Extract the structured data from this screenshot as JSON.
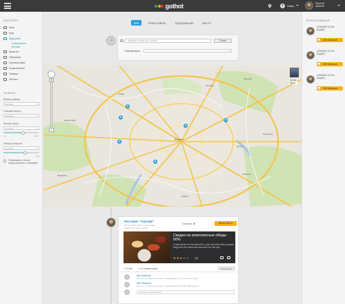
{
  "topbar": {
    "logo_text": "gothot",
    "logo_colors": [
      "#3aa54a",
      "#f5b400",
      "#e0312e"
    ],
    "language": "Нафо",
    "user_name_line1": "Личный",
    "user_name_line2": "кабинет"
  },
  "left": {
    "categories_title": "КАТЕГОРИИ",
    "categories": [
      {
        "label": "Авто",
        "icon": "car-icon"
      },
      {
        "label": "Еда",
        "icon": "fork-icon"
      },
      {
        "label": "Здоровье",
        "icon": "heart-icon",
        "active": true
      },
      {
        "label": "Красота",
        "icon": "lipstick-icon"
      },
      {
        "label": "Обучение",
        "icon": "book-icon"
      },
      {
        "label": "Путешествия",
        "icon": "plane-icon"
      },
      {
        "label": "Развлечения",
        "icon": "ticket-icon"
      },
      {
        "label": "Товары",
        "icon": "bag-icon"
      },
      {
        "label": "Фитнес",
        "icon": "dumbbell-icon"
      }
    ],
    "subcategories": [
      "Стоматология",
      "Нетупки"
    ],
    "filters_title": "ФИЛЬТРЫ",
    "district_label": "Выбор района",
    "district_value": "Выбрать",
    "metro_label": "Станция метро",
    "metro_value": "Выбрать",
    "price_label": "Фильтр цены",
    "price_value": "до 500 тг.",
    "price_min": "0 тг",
    "price_max": "500 тг",
    "bonus_label": "Фильтр бонусов",
    "bonus_value": "до 500 тг.",
    "bonus_min": "0",
    "bonus_max": "300",
    "price_level": 0.55,
    "bonus_level": 0.6,
    "checkbox_label": "Показывать только предложения с отзывами"
  },
  "tabs": [
    "Все",
    "Новости/Блог",
    "Предложения",
    "Места"
  ],
  "search": {
    "placeholder": "Введите слово для поиска",
    "button_label": "Поиск",
    "sort_label": "Сортировать:"
  },
  "map": {
    "side_label_line1": "Оранж",
    "side_label_line2": "Пров",
    "labels": [
      "Москва",
      "Химки",
      "Мытищи",
      "Балашиха",
      "Люберцы",
      "Красногорск",
      "Одинцово",
      "Королёв",
      "Реутов",
      "Видное"
    ]
  },
  "rewards": {
    "title": "ВОЗНАГРАЖДЕНИЕ",
    "items": [
      {
        "text_line1": "АЛЬФАН 16 Gb",
        "text_line2": "(Apple)",
        "badge": "200 бонусов"
      },
      {
        "text_line1": "АЛЬФАН 16 Gb",
        "text_line2": "(Apple)",
        "badge": "200 бонусов"
      },
      {
        "text_line1": "АЛЬФАН 16 Gb",
        "text_line2": "(Apple)",
        "badge": "200 бонусов"
      }
    ]
  },
  "post": {
    "place": "Ресторан \"Тартюф\"",
    "meta1": "25 Сентября 2013 в 2 дня назад",
    "meta2": "Подарите 5 место новых",
    "bonus_label": "Бонусы:",
    "bonus_value": "3",
    "price": "Цена 200 р.",
    "deal_title": "Скидки на комплексные обеды 50%",
    "deal_desc": "A main dinner for the about 50 a. plan and relax with a popular blogs from the owner and become an in the app",
    "rating": "3/5",
    "rating_value": 3,
    "likes": "15 like",
    "comments": "12 Комментарий",
    "share_label": "Поделиться",
    "comments_list": [
      {
        "name": "Имя Фамилия",
        "text": "Так что, тут ничего не понятно, лаборатория, кто-то там и все такие"
      },
      {
        "name": "Имя Фамилия",
        "text": "Так что, тут ничего не понятно, потом звоним пока 500 в 200 бонусов"
      }
    ],
    "add_comment_placeholder": "Добавить комментарий"
  }
}
